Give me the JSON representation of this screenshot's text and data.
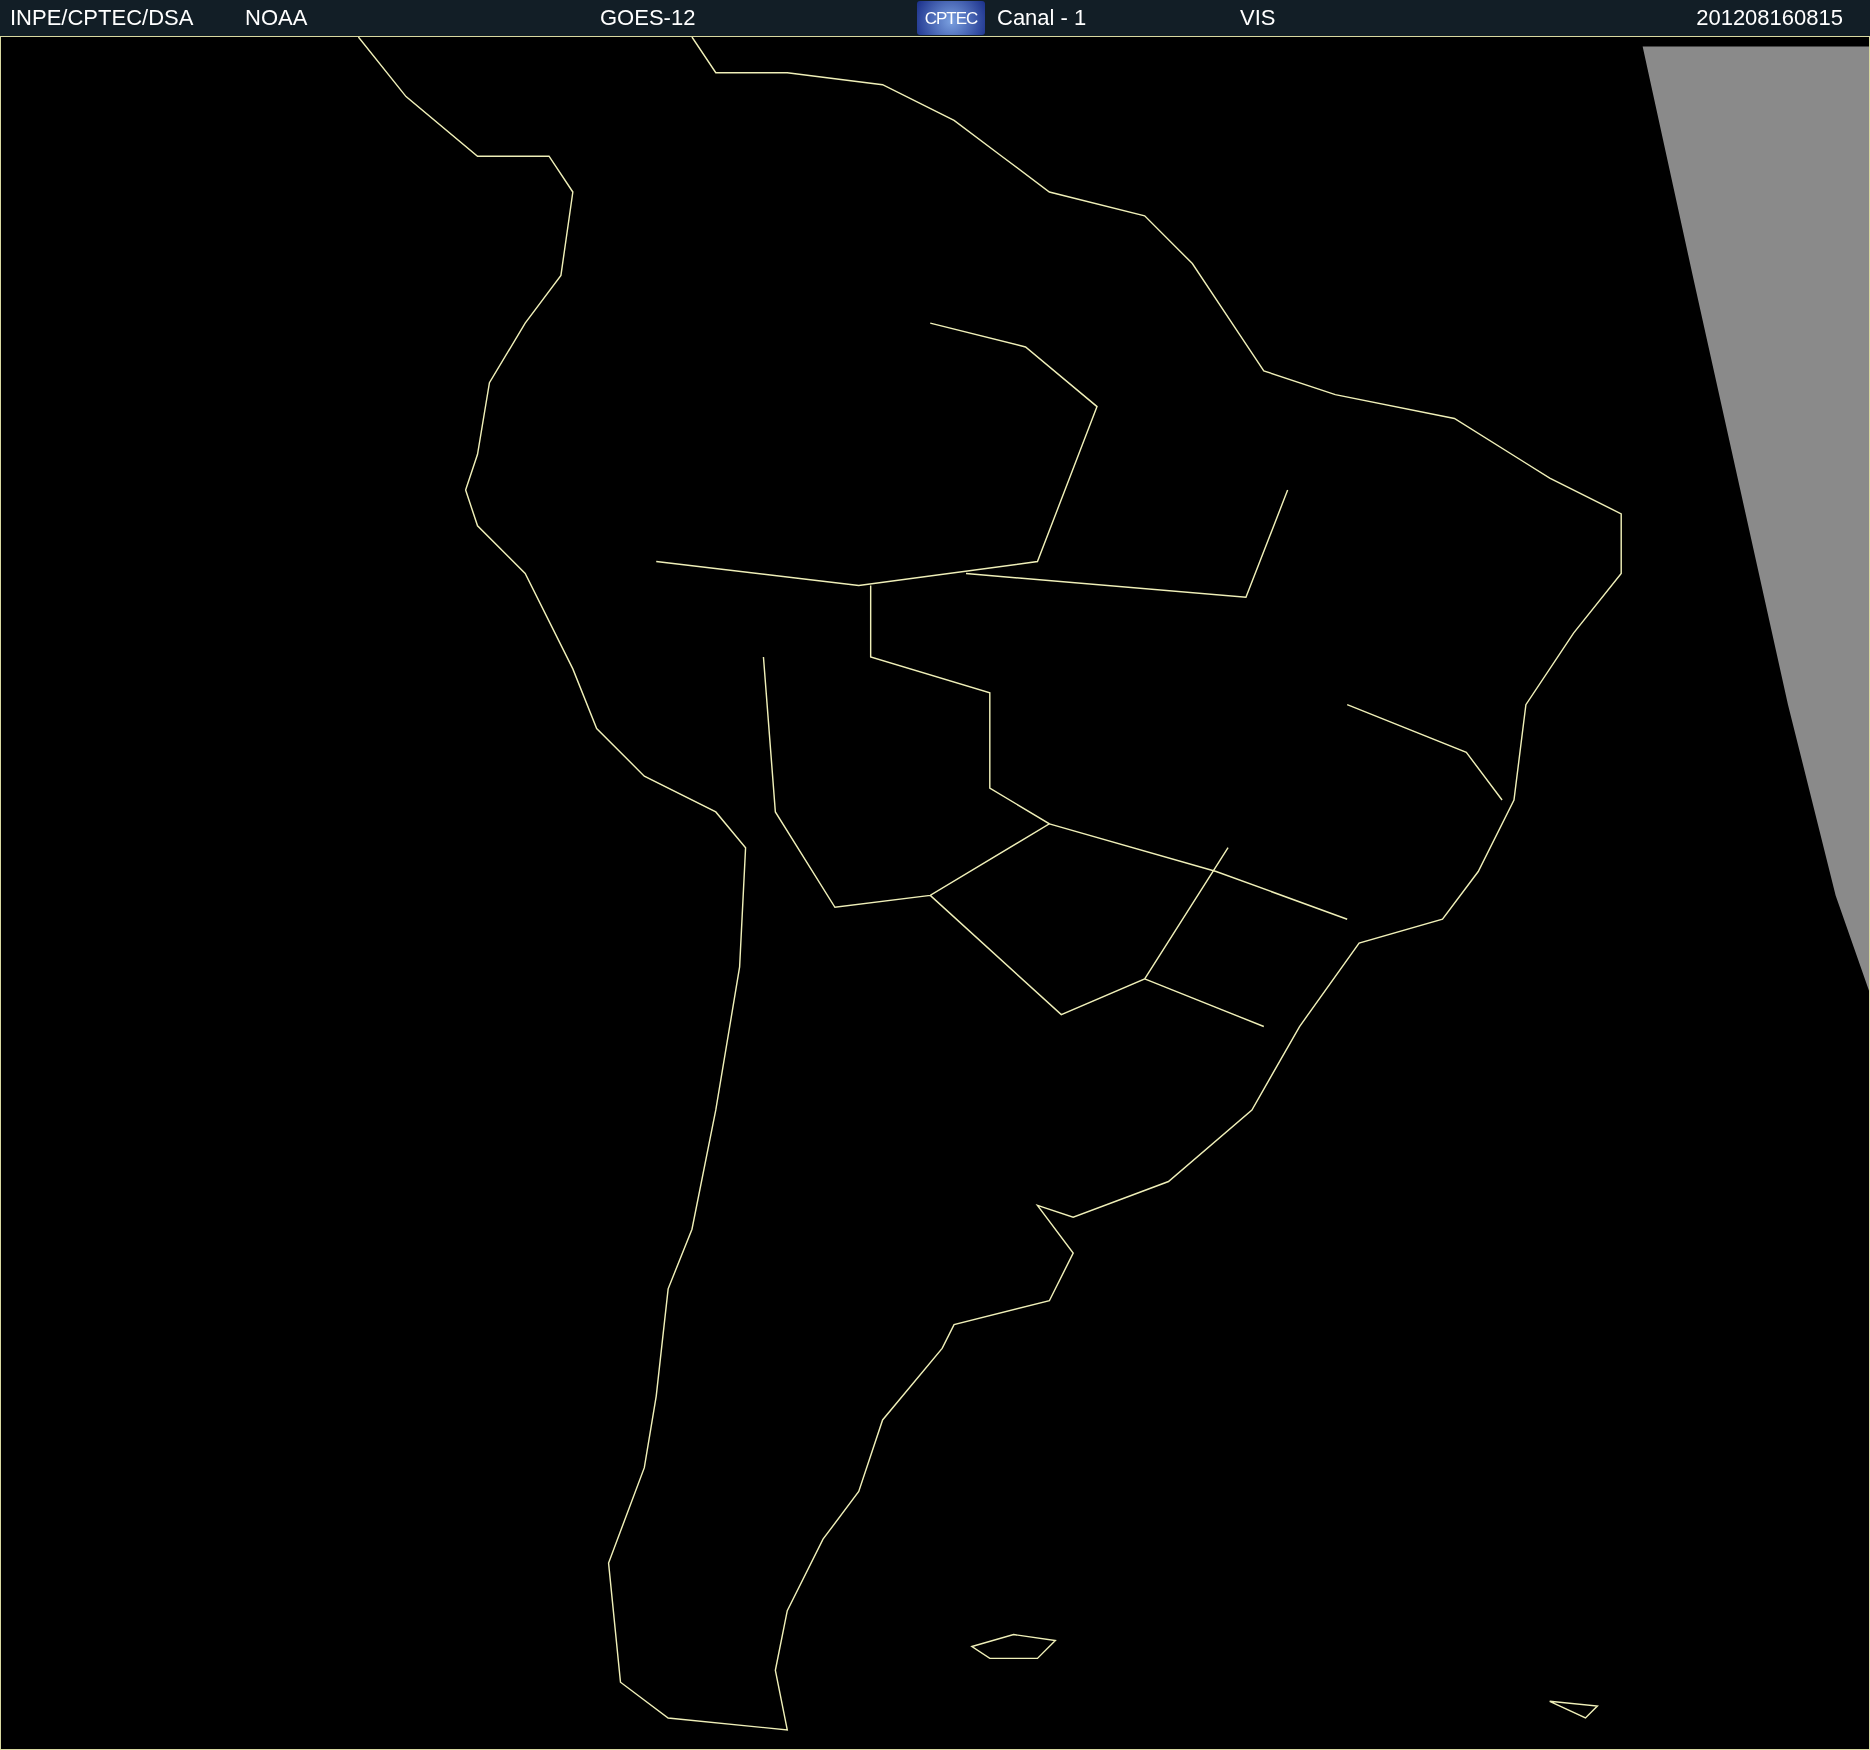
{
  "header": {
    "source": "INPE/CPTEC/DSA",
    "agency": "NOAA",
    "satellite": "GOES-12",
    "logo": "CPTEC",
    "channel": "Canal - 1",
    "band": "VIS",
    "timestamp": "201208160815"
  }
}
